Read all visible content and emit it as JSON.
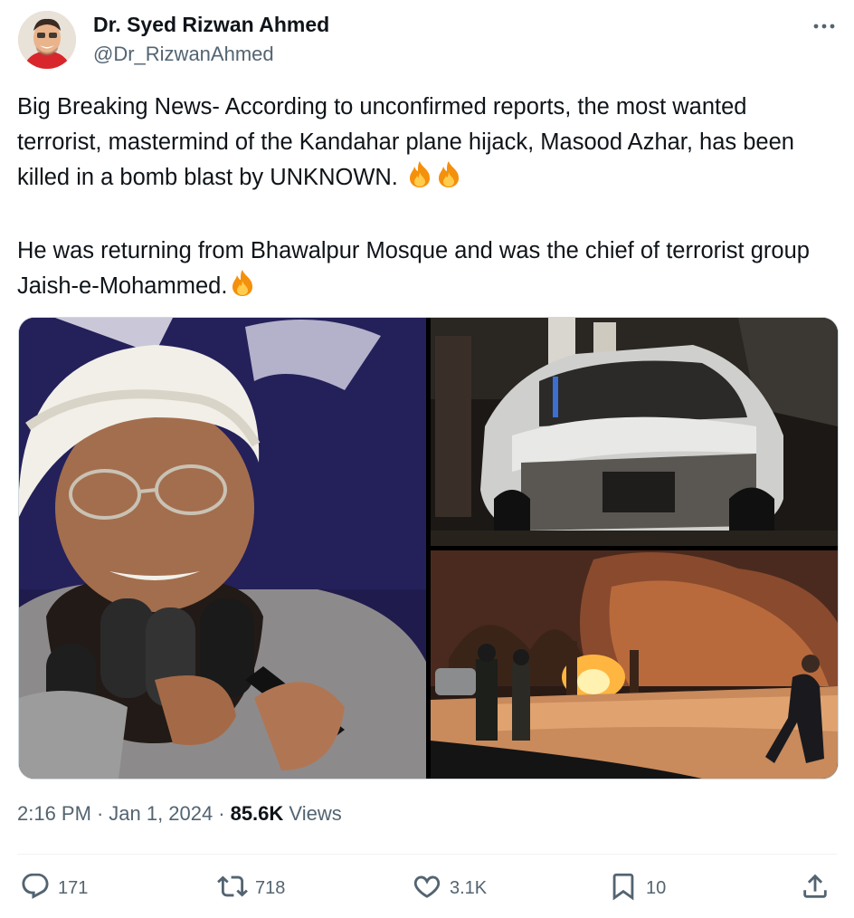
{
  "author": {
    "name": "Dr. Syed Rizwan Ahmed",
    "handle": "@Dr_RizwanAhmed"
  },
  "tweet": {
    "paragraph1": "Big Breaking News- According to unconfirmed reports, the most wanted terrorist, mastermind of the Kandahar plane hijack, Masood Azhar, has been killed in a bomb blast by UNKNOWN.",
    "paragraph2": "He was returning from Bhawalpur Mosque and was the chief of terrorist group Jaish-e-Mohammed.",
    "emoji": "fire"
  },
  "media": {
    "images": [
      "man-with-microphones-photo",
      "wrecked-car-photo",
      "explosion-fire-photo"
    ]
  },
  "meta": {
    "time": "2:16 PM",
    "date": "Jan 1, 2024",
    "views_count": "85.6K",
    "views_label": "Views",
    "separator": "·"
  },
  "actions": {
    "replies": "171",
    "reposts": "718",
    "likes": "3.1K",
    "bookmarks": "10"
  },
  "colors": {
    "text": "#0f1419",
    "secondary": "#536471",
    "divider": "#eff3f4"
  }
}
